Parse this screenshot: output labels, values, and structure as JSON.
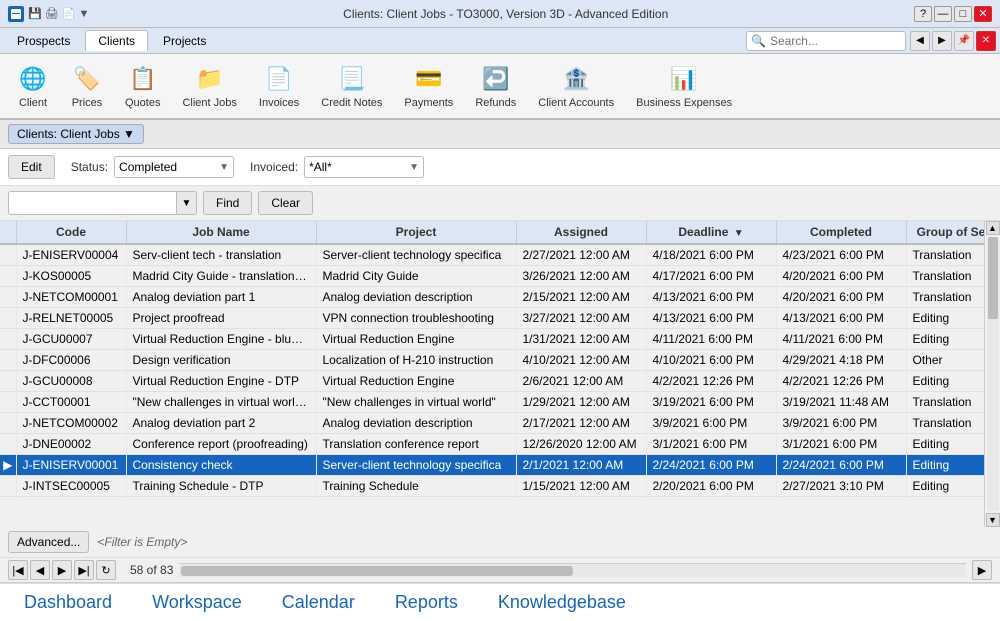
{
  "titleBar": {
    "title": "Clients: Client Jobs - TO3000, Version 3D - Advanced Edition",
    "controls": [
      "?",
      "—",
      "□",
      "✕"
    ]
  },
  "menuBar": {
    "tabs": [
      "Prospects",
      "Clients",
      "Projects"
    ],
    "activeTab": "Clients",
    "search": {
      "placeholder": "Search..."
    }
  },
  "toolbar": {
    "buttons": [
      {
        "id": "client",
        "label": "Client",
        "icon": "👤"
      },
      {
        "id": "prices",
        "label": "Prices",
        "icon": "💲"
      },
      {
        "id": "quotes",
        "label": "Quotes",
        "icon": "📋"
      },
      {
        "id": "client-jobs",
        "label": "Client Jobs",
        "icon": "📁"
      },
      {
        "id": "invoices",
        "label": "Invoices",
        "icon": "📄"
      },
      {
        "id": "credit-notes",
        "label": "Credit Notes",
        "icon": "📃"
      },
      {
        "id": "payments",
        "label": "Payments",
        "icon": "💳"
      },
      {
        "id": "refunds",
        "label": "Refunds",
        "icon": "↩️"
      },
      {
        "id": "client-accounts",
        "label": "Client Accounts",
        "icon": "🏦"
      },
      {
        "id": "business-expenses",
        "label": "Business Expenses",
        "icon": "📊"
      }
    ]
  },
  "breadcrumb": {
    "label": "Clients: Client Jobs ▼"
  },
  "filterBar": {
    "editLabel": "Edit",
    "statusLabel": "Status:",
    "statusValue": "Completed",
    "invoicedLabel": "Invoiced:",
    "invoicedValue": "*All*"
  },
  "searchFilterRow": {
    "inputPlaceholder": "",
    "findLabel": "Find",
    "clearLabel": "Clear"
  },
  "table": {
    "columns": [
      {
        "id": "marker",
        "label": ""
      },
      {
        "id": "code",
        "label": "Code"
      },
      {
        "id": "jobname",
        "label": "Job Name"
      },
      {
        "id": "project",
        "label": "Project"
      },
      {
        "id": "assigned",
        "label": "Assigned"
      },
      {
        "id": "deadline",
        "label": "Deadline"
      },
      {
        "id": "completed",
        "label": "Completed"
      },
      {
        "id": "groupse",
        "label": "Group of Se"
      }
    ],
    "rows": [
      {
        "marker": "",
        "code": "J-ENISERV00004",
        "jobname": "Serv-client tech - translation",
        "project": "Server-client technology specifica",
        "assigned": "2/27/2021 12:00 AM",
        "deadline": "4/18/2021 6:00 PM",
        "completed": "4/23/2021 6:00 PM",
        "group": "Translation",
        "selected": false
      },
      {
        "marker": "",
        "code": "J-KOS00005",
        "jobname": "Madrid City Guide - translation pa",
        "project": "Madrid City Guide",
        "assigned": "3/26/2021 12:00 AM",
        "deadline": "4/17/2021 6:00 PM",
        "completed": "4/20/2021 6:00 PM",
        "group": "Translation",
        "selected": false
      },
      {
        "marker": "",
        "code": "J-NETCOM00001",
        "jobname": "Analog deviation part 1",
        "project": "Analog deviation description",
        "assigned": "2/15/2021 12:00 AM",
        "deadline": "4/13/2021 6:00 PM",
        "completed": "4/20/2021 6:00 PM",
        "group": "Translation",
        "selected": false
      },
      {
        "marker": "",
        "code": "J-RELNET00005",
        "jobname": "Project proofread",
        "project": "VPN connection troubleshooting",
        "assigned": "3/27/2021 12:00 AM",
        "deadline": "4/13/2021 6:00 PM",
        "completed": "4/13/2021 6:00 PM",
        "group": "Editing",
        "selected": false
      },
      {
        "marker": "",
        "code": "J-GCU00007",
        "jobname": "Virtual Reduction Engine - bluepri",
        "project": "Virtual Reduction Engine",
        "assigned": "1/31/2021 12:00 AM",
        "deadline": "4/11/2021 6:00 PM",
        "completed": "4/11/2021 6:00 PM",
        "group": "Editing",
        "selected": false
      },
      {
        "marker": "",
        "code": "J-DFC00006",
        "jobname": "Design verification",
        "project": "Localization of H-210 instruction",
        "assigned": "4/10/2021 12:00 AM",
        "deadline": "4/10/2021 6:00 PM",
        "completed": "4/29/2021 4:18 PM",
        "group": "Other",
        "selected": false
      },
      {
        "marker": "",
        "code": "J-GCU00008",
        "jobname": "Virtual Reduction Engine - DTP",
        "project": "Virtual Reduction Engine",
        "assigned": "2/6/2021 12:00 AM",
        "deadline": "4/2/2021 12:26 PM",
        "completed": "4/2/2021 12:26 PM",
        "group": "Editing",
        "selected": false
      },
      {
        "marker": "",
        "code": "J-CCT00001",
        "jobname": "\"New challenges in virtual world\" a",
        "project": "\"New challenges in virtual world\"",
        "assigned": "1/29/2021 12:00 AM",
        "deadline": "3/19/2021 6:00 PM",
        "completed": "3/19/2021 11:48 AM",
        "group": "Translation",
        "selected": false
      },
      {
        "marker": "",
        "code": "J-NETCOM00002",
        "jobname": "Analog deviation part 2",
        "project": "Analog deviation description",
        "assigned": "2/17/2021 12:00 AM",
        "deadline": "3/9/2021 6:00 PM",
        "completed": "3/9/2021 6:00 PM",
        "group": "Translation",
        "selected": false
      },
      {
        "marker": "",
        "code": "J-DNE00002",
        "jobname": "Conference report (proofreading)",
        "project": "Translation conference report",
        "assigned": "12/26/2020 12:00 AM",
        "deadline": "3/1/2021 6:00 PM",
        "completed": "3/1/2021 6:00 PM",
        "group": "Editing",
        "selected": false
      },
      {
        "marker": "▶",
        "code": "J-ENISERV00001",
        "jobname": "Consistency check",
        "project": "Server-client technology specifica",
        "assigned": "2/1/2021 12:00 AM",
        "deadline": "2/24/2021 6:00 PM",
        "completed": "2/24/2021 6:00 PM",
        "group": "Editing",
        "selected": true
      },
      {
        "marker": "",
        "code": "J-INTSEC00005",
        "jobname": "Training Schedule - DTP",
        "project": "Training Schedule",
        "assigned": "1/15/2021 12:00 AM",
        "deadline": "2/20/2021 6:00 PM",
        "completed": "2/27/2021 3:10 PM",
        "group": "Editing",
        "selected": false
      }
    ]
  },
  "bottomFilter": {
    "advancedLabel": "Advanced...",
    "filterStatus": "<Filter is Empty>"
  },
  "pagination": {
    "info": "58 of 83"
  },
  "bottomNav": {
    "items": [
      "Dashboard",
      "Workspace",
      "Calendar",
      "Reports",
      "Knowledgebase"
    ]
  }
}
